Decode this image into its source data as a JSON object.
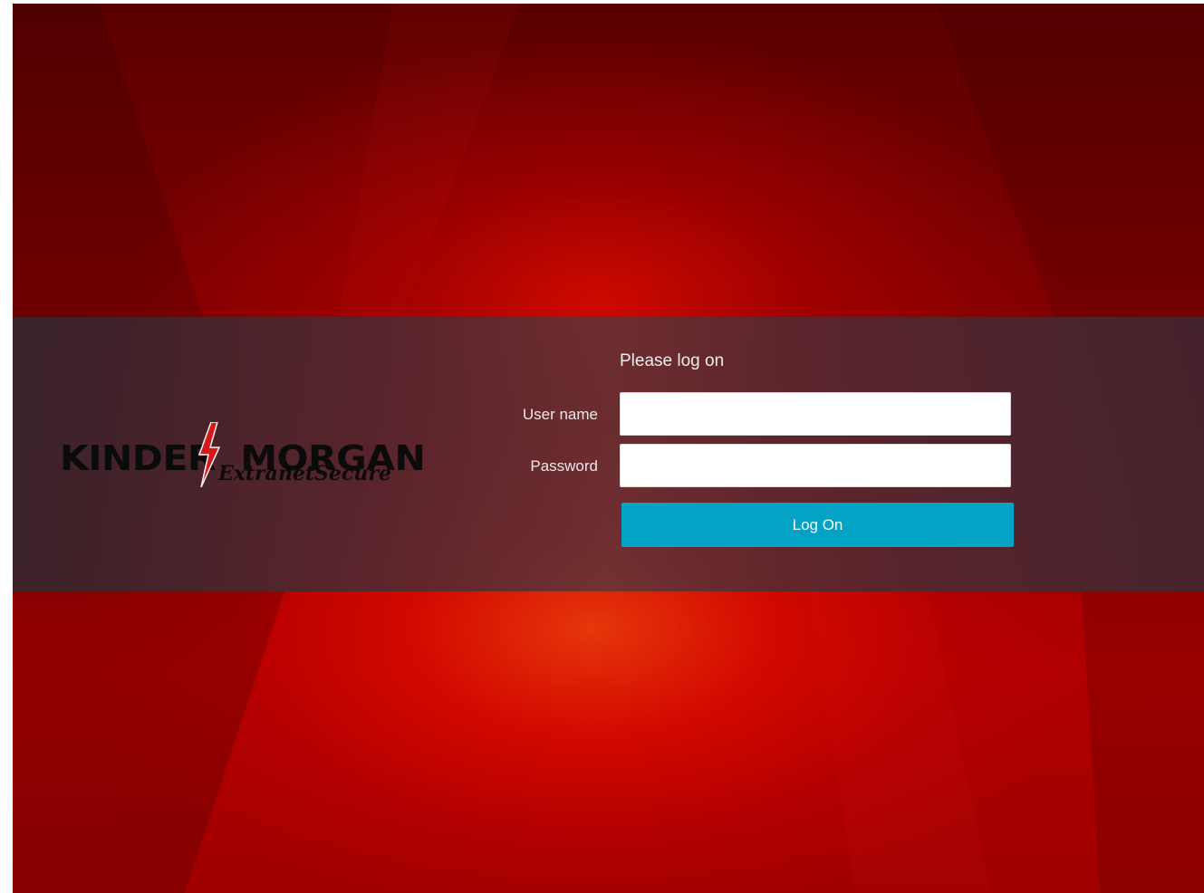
{
  "logo": {
    "brand_name": "KINDER  MORGAN",
    "product": "ExtranetSecure"
  },
  "login": {
    "title": "Please log on",
    "username_label": "User name",
    "username_value": "",
    "password_label": "Password",
    "password_value": "",
    "submit_label": "Log On"
  },
  "colors": {
    "background": "#8a0000",
    "band": "#4a2c36",
    "button": "#02a3c4",
    "bolt": "#d21a1a"
  }
}
